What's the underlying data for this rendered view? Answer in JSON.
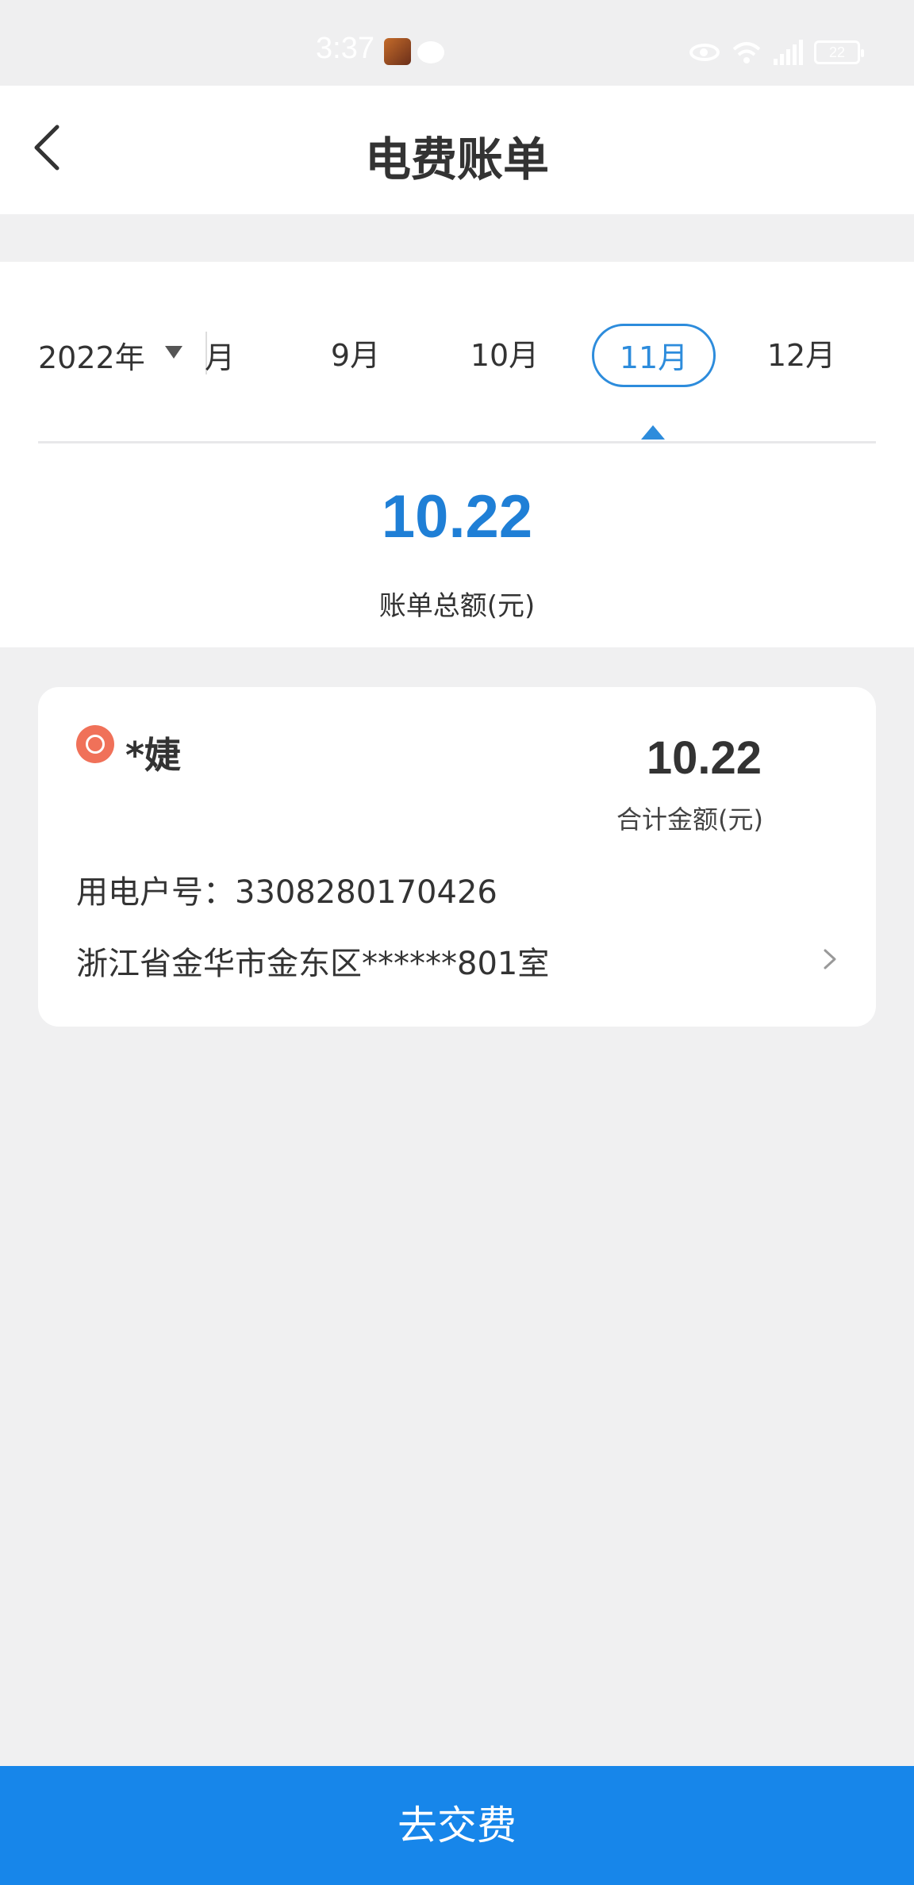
{
  "status_bar": {
    "time": "3:37",
    "battery": "22"
  },
  "header": {
    "title": "电费账单"
  },
  "month_selector": {
    "year": "2022年",
    "partial_month": "月",
    "months": [
      {
        "label": "9月",
        "selected": false
      },
      {
        "label": "10月",
        "selected": false
      },
      {
        "label": "11月",
        "selected": true
      },
      {
        "label": "12月",
        "selected": false
      }
    ]
  },
  "summary": {
    "total_amount": "10.22",
    "total_label": "账单总额(元)"
  },
  "account_card": {
    "owner_name": "*婕",
    "amount": "10.22",
    "amount_label": "合计金额(元)",
    "account_no": "用电户号：3308280170426",
    "address": "浙江省金华市金东区******801室"
  },
  "footer": {
    "pay_button_label": "去交费"
  },
  "colors": {
    "accent": "#1f7fd6",
    "pay_button": "#1786ea",
    "owner_icon": "#f07159"
  }
}
